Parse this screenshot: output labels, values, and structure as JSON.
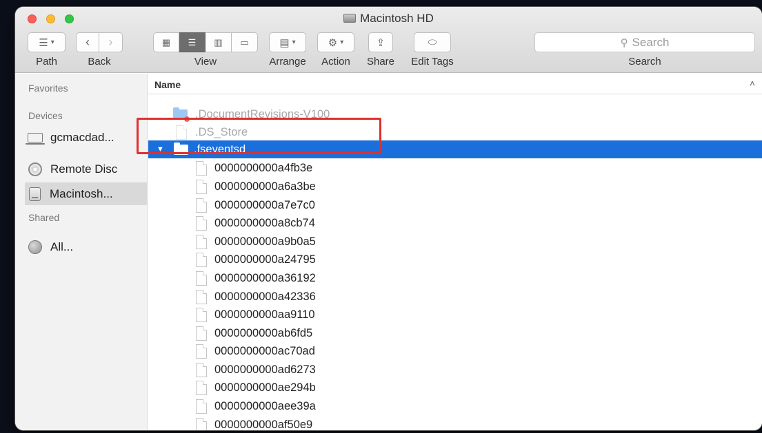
{
  "window": {
    "title": "Macintosh HD"
  },
  "toolbar": {
    "path_label": "Path",
    "back_label": "Back",
    "view_label": "View",
    "arrange_label": "Arrange",
    "action_label": "Action",
    "share_label": "Share",
    "edit_tags_label": "Edit Tags",
    "search_label": "Search",
    "search_placeholder": "Search",
    "view_mode_selected": "list"
  },
  "sidebar": {
    "favorites_heading": "Favorites",
    "devices_heading": "Devices",
    "devices": [
      {
        "label": "gcmacdad...",
        "icon": "laptop-icon"
      },
      {
        "label": "Remote Disc",
        "icon": "disc-icon"
      },
      {
        "label": "Macintosh...",
        "icon": "hard-drive-icon",
        "selected": true
      }
    ],
    "shared_heading": "Shared",
    "shared": [
      {
        "label": "All...",
        "icon": "network-globe-icon"
      }
    ]
  },
  "list": {
    "column_name": "Name",
    "top_items": [
      {
        "name": ".DocumentRevisions-V100",
        "type": "folder",
        "hidden": true
      },
      {
        "name": ".DS_Store",
        "type": "file",
        "hidden": true
      },
      {
        "name": ".fseventsd",
        "type": "folder",
        "expanded": true,
        "selected": true
      }
    ],
    "children": [
      "0000000000a4fb3e",
      "0000000000a6a3be",
      "0000000000a7e7c0",
      "0000000000a8cb74",
      "0000000000a9b0a5",
      "0000000000a24795",
      "0000000000a36192",
      "0000000000a42336",
      "0000000000aa9110",
      "0000000000ab6fd5",
      "0000000000ac70ad",
      "0000000000ad6273",
      "0000000000ae294b",
      "0000000000aee39a",
      "0000000000af50e9"
    ]
  },
  "colors": {
    "selection": "#1a6fdb",
    "annotation_box": "#e0302d"
  }
}
